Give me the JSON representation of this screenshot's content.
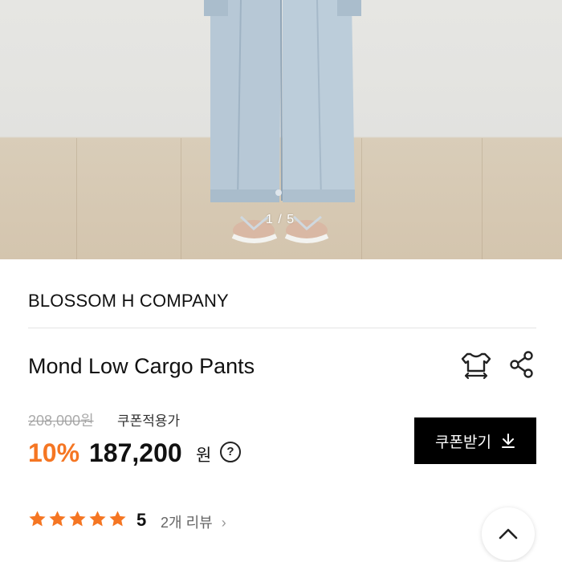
{
  "gallery": {
    "current": "1",
    "separator": "/",
    "total": "5",
    "icon": "product-photo-cargo-pants"
  },
  "product": {
    "brand": "BLOSSOM H COMPANY",
    "name": "Mond Low Cargo Pants",
    "size_icon": "tshirt-size-icon",
    "share_icon": "share-icon"
  },
  "pricing": {
    "original_price": "208,000원",
    "coupon_label": "쿠폰적용가",
    "discount_percent": "10%",
    "sale_price": "187,200",
    "currency": "원",
    "help": "?",
    "discount_color": "#f57623"
  },
  "coupon_button": {
    "label": "쿠폰받기",
    "icon": "download-arrow-icon"
  },
  "rating": {
    "stars": 5,
    "star_color": "#f57623",
    "score": "5",
    "review_count": "2개 리뷰",
    "chevron": "›"
  },
  "scroll_top": {
    "icon": "chevron-up-icon"
  }
}
